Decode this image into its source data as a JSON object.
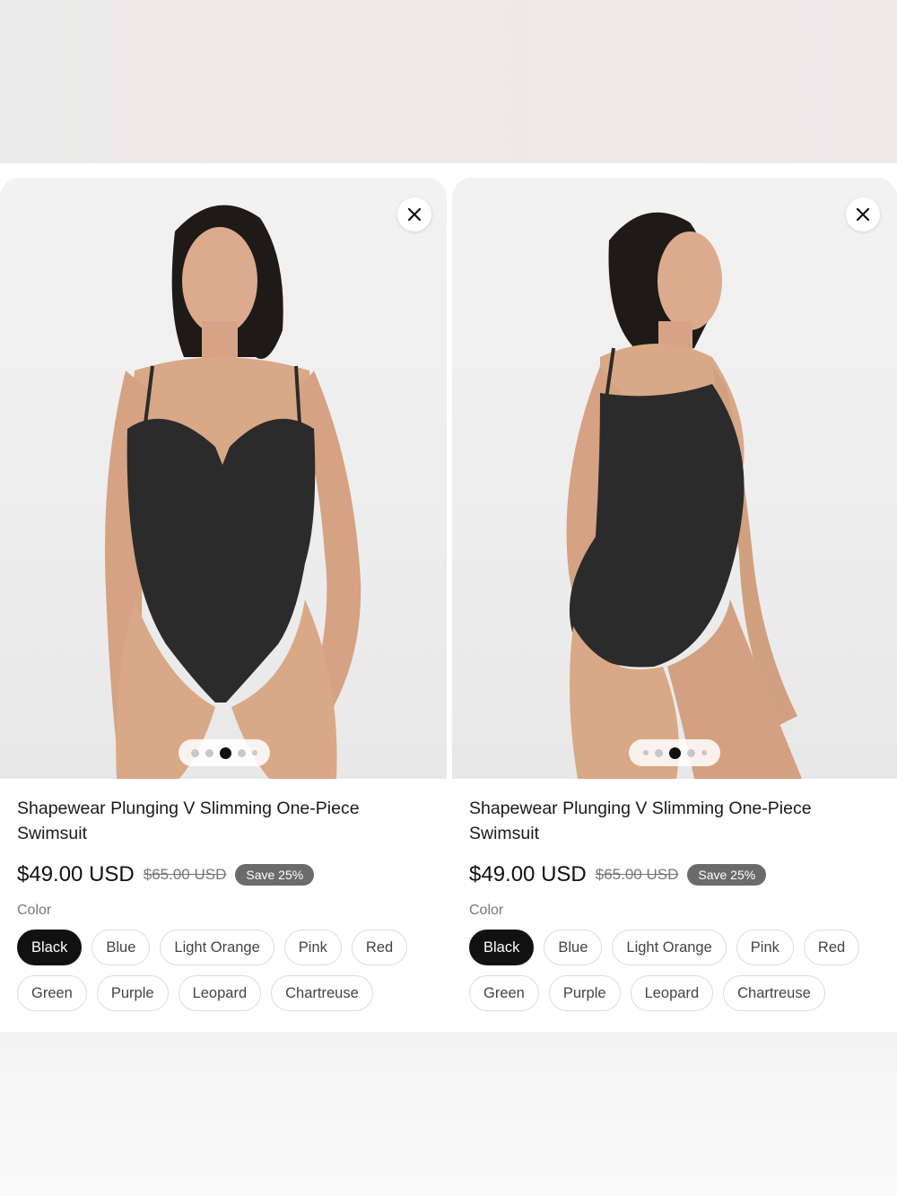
{
  "cards": [
    {
      "title": "Shapewear Plunging V Slimming One-Piece Swimsuit",
      "price": "$49.00 USD",
      "compare_price": "$65.00 USD",
      "save_badge": "Save 25%",
      "color_label": "Color",
      "colors": [
        "Black",
        "Blue",
        "Light Orange",
        "Pink",
        "Red",
        "Green",
        "Purple",
        "Leopard",
        "Chartreuse"
      ],
      "selected_color": "Black",
      "image_dots_active_index": 2,
      "image_dots_count": 5
    },
    {
      "title": "Shapewear Plunging V Slimming One-Piece Swimsuit",
      "price": "$49.00 USD",
      "compare_price": "$65.00 USD",
      "save_badge": "Save 25%",
      "color_label": "Color",
      "colors": [
        "Black",
        "Blue",
        "Light Orange",
        "Pink",
        "Red",
        "Green",
        "Purple",
        "Leopard",
        "Chartreuse"
      ],
      "selected_color": "Black",
      "image_dots_active_index": 2,
      "image_dots_count": 5
    }
  ],
  "icons": {
    "close": "close-icon"
  },
  "colors_theme": {
    "selected_bg": "#111111",
    "badge_bg": "#6b6b6b",
    "photo_bg": "#efefef",
    "swimsuit": "#2b2b2b",
    "skin": "#d9a887"
  }
}
